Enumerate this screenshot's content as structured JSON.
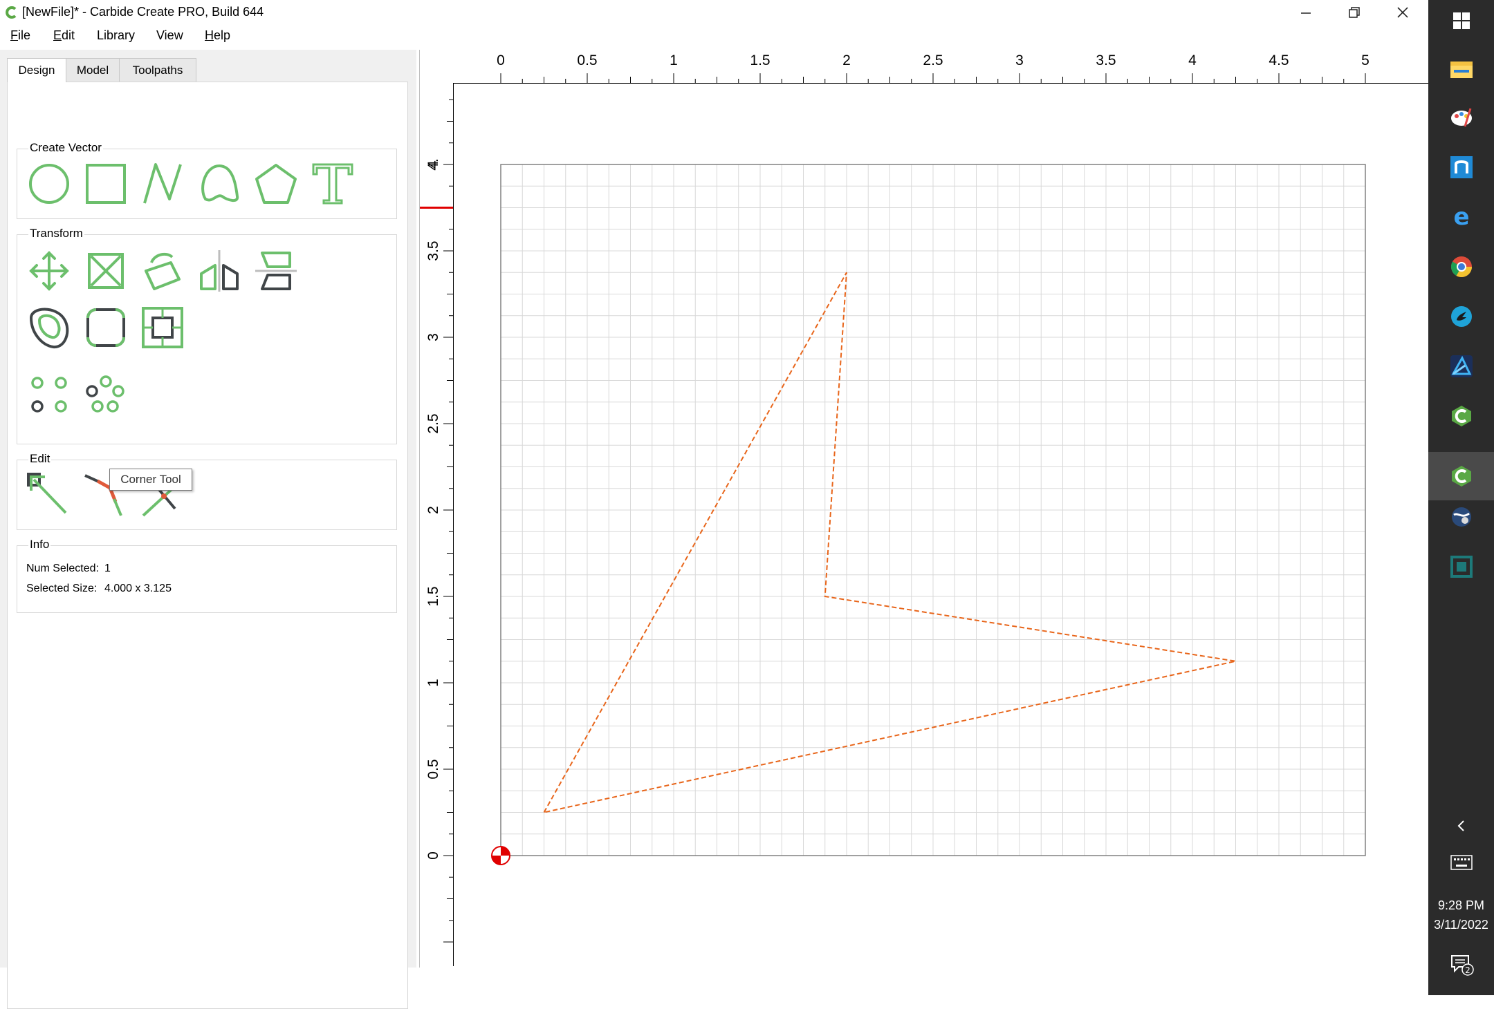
{
  "window": {
    "title": "[NewFile]* - Carbide Create PRO, Build 644",
    "buttons": [
      "minimize",
      "restore",
      "close"
    ]
  },
  "menu": [
    {
      "label": "File",
      "accel": "F",
      "rest": "ile"
    },
    {
      "label": "Edit",
      "accel": "E",
      "rest": "dit"
    },
    {
      "label": "Library",
      "accel": "",
      "rest": "Library"
    },
    {
      "label": "View",
      "accel": "",
      "rest": "View"
    },
    {
      "label": "Help",
      "accel": "H",
      "rest": "elp"
    }
  ],
  "tabs": [
    "Design",
    "Model",
    "Toolpaths"
  ],
  "active_tab": "Design",
  "groups": {
    "create_vector": "Create Vector",
    "transform": "Transform",
    "edit": "Edit",
    "info": "Info"
  },
  "tooltip": "Corner Tool",
  "info": {
    "num_selected_label": "Num Selected:",
    "num_selected_value": "1",
    "selected_size_label": "Selected Size:",
    "selected_size_value": "4.000 x 3.125"
  },
  "ruler": {
    "x_labels": [
      "0",
      "0.5",
      "1",
      "1.5",
      "2",
      "2.5",
      "3",
      "3.5",
      "4",
      "4.5",
      "5"
    ],
    "y_labels": [
      "0",
      "0.5",
      "1",
      "1.5",
      "2",
      "2.5",
      "3",
      "3.5",
      "4",
      "4."
    ],
    "y_marker": 3.75
  },
  "shape": {
    "color": "#e8651a",
    "points": [
      [
        0.25,
        0.25
      ],
      [
        2.0,
        3.375
      ],
      [
        1.875,
        1.5
      ],
      [
        4.25,
        1.125
      ]
    ]
  },
  "colors": {
    "accent_green": "#6cbf6c",
    "tool_dark": "#404548",
    "tool_red": "#e05a3a",
    "grid": "#d8d8d8",
    "taskbar": "#2b2b2b"
  },
  "taskbar": {
    "time": "9:28 PM",
    "date": "3/11/2022",
    "notifications": "2",
    "icons": [
      "windows-start-icon",
      "file-explorer-icon",
      "paint-icon",
      "onenote-icon",
      "edge-icon",
      "chrome-icon",
      "app-icon",
      "affinity-icon",
      "carbide-create-icon",
      "carbide-create-active-icon",
      "globe-icon",
      "carbide-motion-icon"
    ]
  }
}
